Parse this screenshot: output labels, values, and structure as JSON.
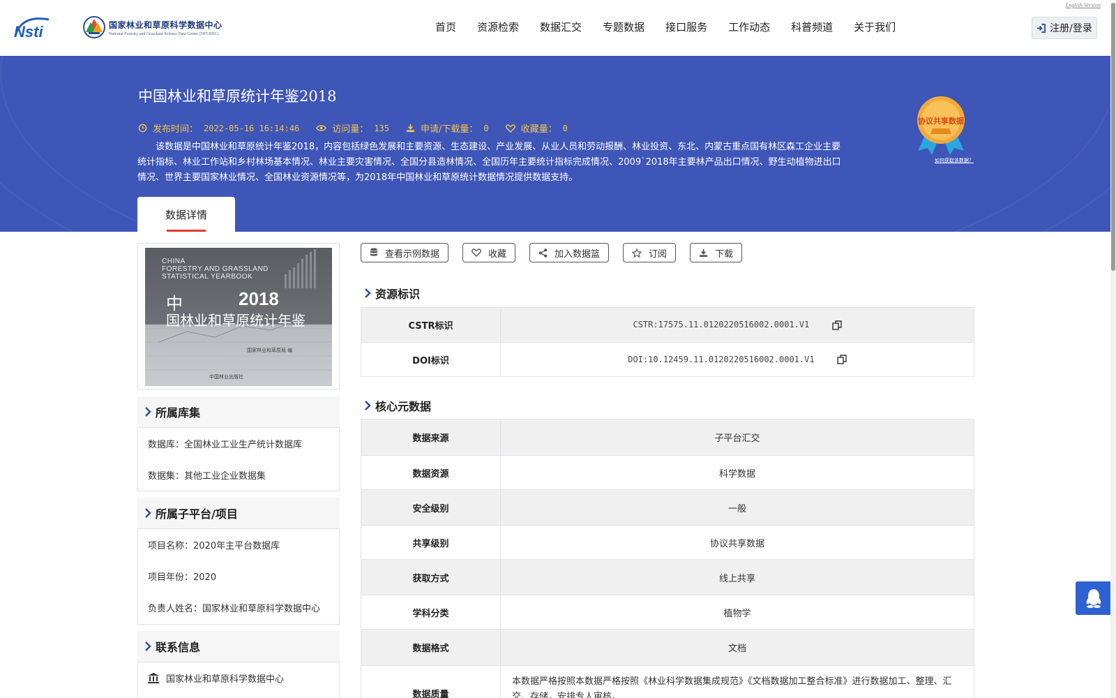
{
  "header": {
    "logo_nsti": "Nsti",
    "logo_cn": "国家林业和草原科学数据中心",
    "logo_en": "National Forestry and Grassland Science Data Center (NFGSDC)",
    "english_link": "English Version",
    "nav": [
      "首页",
      "资源检索",
      "数据汇交",
      "专题数据",
      "接口服务",
      "工作动态",
      "科普频道",
      "关于我们"
    ],
    "login_label": "注册/登录"
  },
  "banner": {
    "title": "中国林业和草原统计年鉴2018",
    "publish_label": "发布时间：",
    "publish_value": "2022-05-16 16:14:46",
    "views_label": "访问量：",
    "views_value": "135",
    "downloads_label": "申请/下载量：",
    "downloads_value": "0",
    "favorites_label": "收藏量：",
    "favorites_value": "0",
    "description": "该数据是中国林业和草原统计年鉴2018，内容包括绿色发展和主要资源、生态建设、产业发展、从业人员和劳动报酬、林业投资、东北、内蒙古重点国有林区森工企业主要统计指标、林业工作站和乡村林场基本情况、林业主要灾害情况、全国分县造林情况、全国历年主要统计指标完成情况、2009`2018年主要林产品出口情况、野生动植物进出口情况、世界主要国家林业情况、全国林业资源情况等，为2018年中国林业和草原统计数据情况提供数据支持。",
    "badge_label": "协议共享数据",
    "badge_help": "如何获取该数据？",
    "tab_label": "数据详情"
  },
  "cover": {
    "en_line1": "CHINA",
    "en_line2": "FORESTRY AND GRASSLAND",
    "en_line3": "STATISTICAL YEARBOOK",
    "year": "2018",
    "zhong": "中",
    "cn_title": "国林业和草原统计年鉴",
    "publisher": "国家林业和草原局 编",
    "press": "中国林业出版社"
  },
  "sidebar": {
    "library_title": "所属库集",
    "database_label": "数据库：",
    "database_value": "全国林业工业生产统计数据库",
    "dataset_label": "数据集：",
    "dataset_value": "其他工业企业数据集",
    "platform_title": "所属子平台/项目",
    "project_name_label": "项目名称：",
    "project_name_value": "2020年主平台数据库",
    "project_year_label": "项目年份：",
    "project_year_value": "2020",
    "owner_label": "负责人姓名：",
    "owner_value": "国家林业和草原科学数据中心",
    "contact_title": "联系信息",
    "contact_org": "国家林业和草原科学数据中心"
  },
  "actions": [
    "查看示例数据",
    "收藏",
    "加入数据篮",
    "订阅",
    "下载"
  ],
  "resource_id": {
    "title": "资源标识",
    "rows": [
      {
        "key": "CSTR标识",
        "value": "CSTR:17575.11.0120220516002.0001.V1"
      },
      {
        "key": "DOI标识",
        "value": "DOI:10.12459.11.0120220516002.0001.V1"
      }
    ]
  },
  "core_meta": {
    "title": "核心元数据",
    "rows": [
      {
        "key": "数据来源",
        "value": "子平台汇交"
      },
      {
        "key": "数据资源",
        "value": "科学数据"
      },
      {
        "key": "安全级别",
        "value": "一般"
      },
      {
        "key": "共享级别",
        "value": "协议共享数据"
      },
      {
        "key": "获取方式",
        "value": "线上共享"
      },
      {
        "key": "学科分类",
        "value": "植物学"
      },
      {
        "key": "数据格式",
        "value": "文档"
      }
    ],
    "quality_key": "数据质量",
    "quality_value": "本数据严格按照本数据严格按照《林业科学数据集成规范》《文档数据加工整合标准》进行数据加工、整理、汇交、存储，安排专人审核。"
  },
  "colors": {
    "banner": "#3e56b8",
    "meta": "#f4c24a",
    "accent_red": "#e23a2e",
    "qq_button": "#2f62d1"
  },
  "icons": {
    "qq": "qq-penguin-icon",
    "login": "sign-in-icon"
  }
}
